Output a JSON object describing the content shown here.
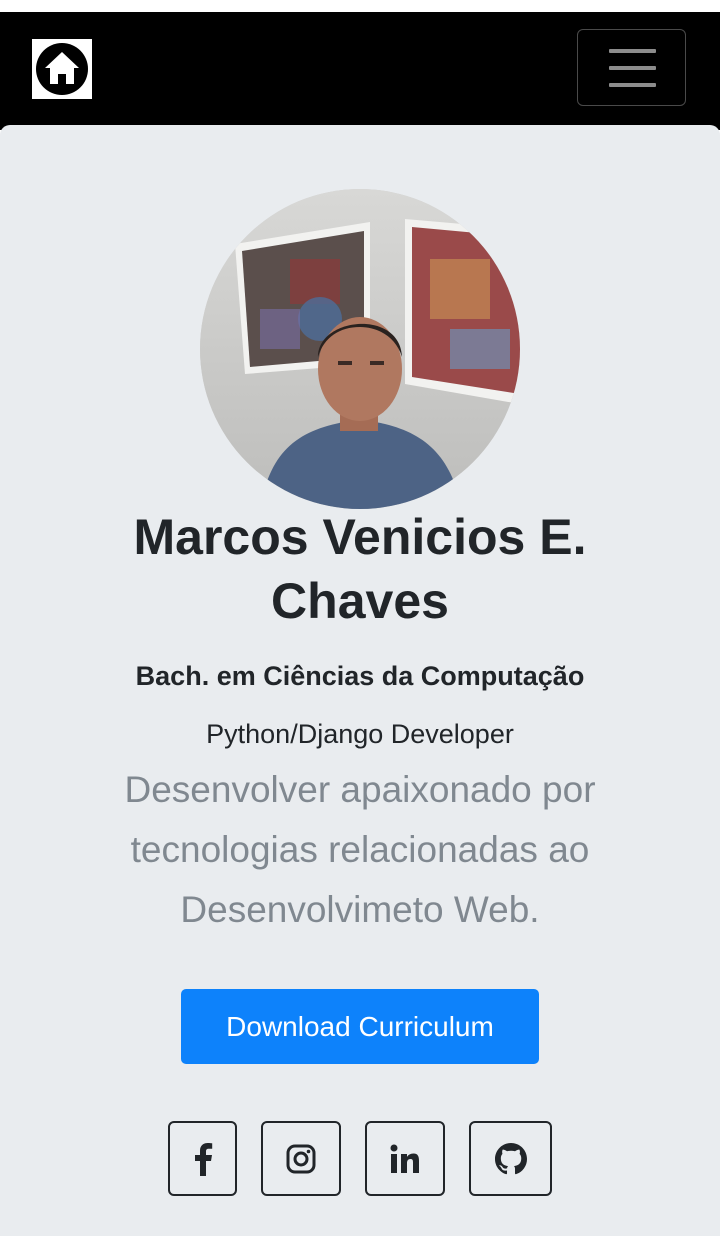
{
  "navbar": {
    "home_icon": "home-icon",
    "menu_icon": "hamburger-icon"
  },
  "profile": {
    "name": "Marcos Venicios E. Chaves",
    "degree": "Bach. em Ciências da Computação",
    "role": "Python/Django Developer",
    "description": "Desenvolver apaixonado por tecnologias relacionadas ao Desenvolvimeto Web."
  },
  "actions": {
    "download_label": "Download Curriculum"
  },
  "social": [
    {
      "icon": "facebook-icon"
    },
    {
      "icon": "instagram-icon"
    },
    {
      "icon": "linkedin-icon"
    },
    {
      "icon": "github-icon"
    }
  ],
  "colors": {
    "navbar": "#000000",
    "card": "#e9ecef",
    "primary": "#0d82fb",
    "text": "#212529",
    "muted": "#808890"
  }
}
